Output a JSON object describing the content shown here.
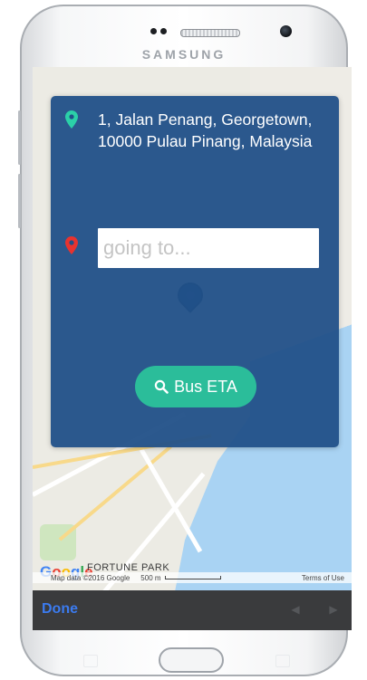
{
  "device": {
    "brand": "SAMSUNG"
  },
  "colors": {
    "panel": "#215088",
    "origin_pin": "#2bd0a8",
    "destination_pin": "#e8332f",
    "eta_button": "#2bbd9a",
    "done": "#3b7bf0"
  },
  "panel": {
    "origin": {
      "icon": "map-marker-icon",
      "address": "1, Jalan Penang, Georgetown, 10000 Pulau Pinang, Malaysia"
    },
    "destination": {
      "icon": "map-marker-icon",
      "placeholder": "going to...",
      "value": ""
    },
    "eta_button": {
      "icon": "search-icon",
      "label": "Bus ETA"
    }
  },
  "map": {
    "google_logo": "Google",
    "place_label": "FORTUNE PARK",
    "map_data": "Map data ©2016 Google",
    "scale_label": "500 m",
    "terms": "Terms of Use"
  },
  "toolbar": {
    "done_label": "Done",
    "prev_icon": "chevron-left-icon",
    "next_icon": "chevron-right-icon"
  }
}
